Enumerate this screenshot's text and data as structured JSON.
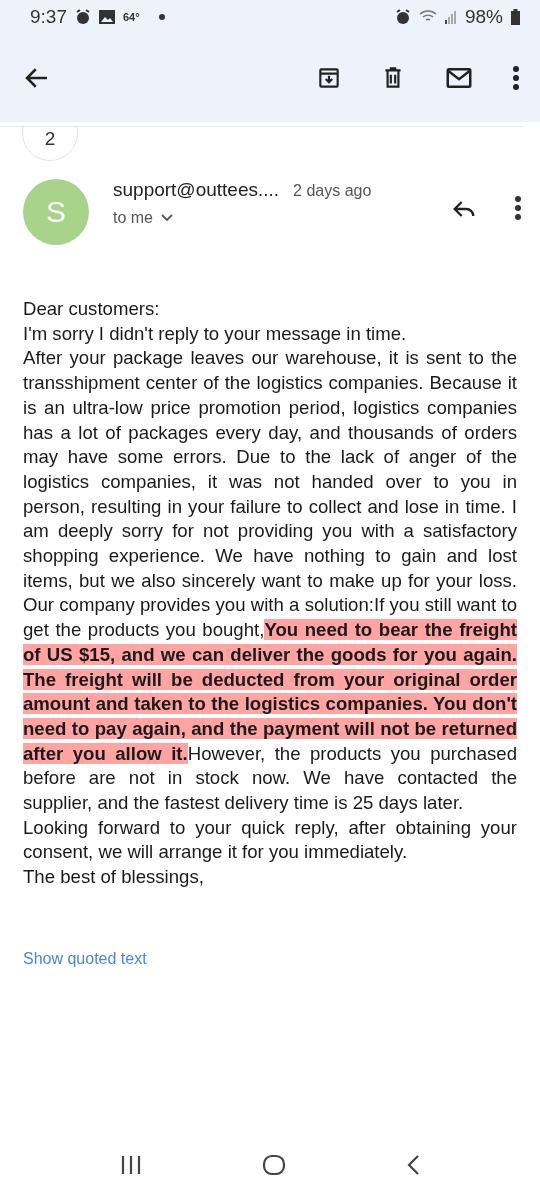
{
  "status_bar": {
    "time": "9:37",
    "temperature": "64°",
    "battery": "98%"
  },
  "thread_count": "2",
  "message": {
    "avatar_initial": "S",
    "sender": "support@outtees....",
    "time": "2 days ago",
    "recipient": "to me",
    "body": [
      "Dear customers:",
      "I'm sorry I didn't reply to your message in time.",
      "After your package leaves our warehouse, it is sent to the transshipment center of the logistics companies. Because it is an ultra-low price promotion period, logistics companies has a lot of packages every day, and thousands of orders may have some errors. Due to the lack of anger of the logistics companies, it was not handed over to you in person, resulting in your failure to collect and lose in time. I am deeply sorry for not providing you with a satisfactory shopping experience. We have nothing to gain and lost items, but we also sincerely want to make up for your loss. Our company provides you with a solution:If you still want to get the products you bought,**You need to bear the freight of US $15, and we can deliver the goods for you again. The freight will be deducted from your original order amount and taken to the logistics companies. You don't need to pay again, and the payment will not be returned after you allow it.**However, the products you purchased before are not in stock now. We have contacted the supplier, and the fastest delivery time is 25 days later.",
      "Looking forward to your quick reply, after obtaining your consent, we will arrange it for you immediately.",
      "The best of blessings,"
    ],
    "show_quoted": "Show quoted text"
  }
}
